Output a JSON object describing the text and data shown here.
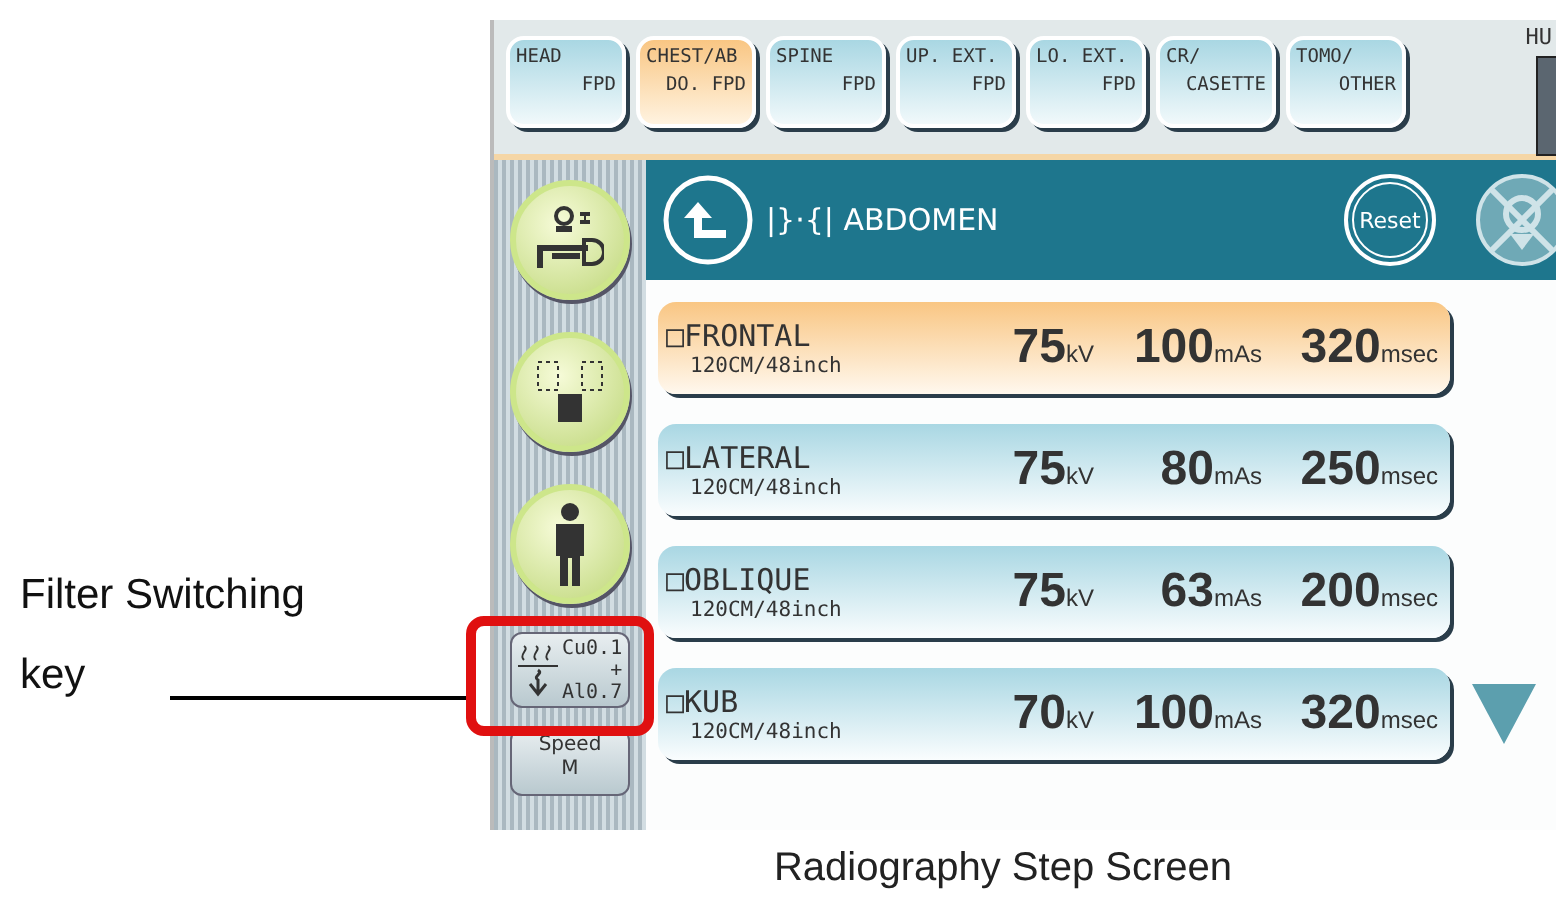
{
  "annotation": {
    "label": "Filter Switching",
    "label_line_2": "key"
  },
  "tabs": [
    {
      "line1": "HEAD",
      "line2": "FPD",
      "selected": false
    },
    {
      "line1": "CHEST/AB",
      "line2": "DO. FPD",
      "selected": true
    },
    {
      "line1": "SPINE",
      "line2": "FPD",
      "selected": false
    },
    {
      "line1": "UP. EXT.",
      "line2": "FPD",
      "selected": false
    },
    {
      "line1": "LO. EXT.",
      "line2": "FPD",
      "selected": false
    },
    {
      "line1": "CR/",
      "line2": "CASETTE",
      "selected": false
    },
    {
      "line1": "TOMO/",
      "line2": "OTHER",
      "selected": false
    }
  ],
  "corner_label": "HU",
  "sidebar": {
    "buttons": [
      {
        "kind": "table"
      },
      {
        "kind": "detector"
      },
      {
        "kind": "person"
      }
    ],
    "filter_key": {
      "top": "Cu0.1",
      "plus": "+",
      "bottom": "Al0.7"
    },
    "speed_key": {
      "label": "Speed",
      "value": "M"
    }
  },
  "header": {
    "title": "|}·{| ABDOMEN",
    "reset": "Reset"
  },
  "steps": [
    {
      "checkbox": "□",
      "name": "FRONTAL",
      "distance": "120CM/48inch",
      "kv": "75",
      "kv_unit": "kV",
      "mas": "100",
      "mas_unit": "mAs",
      "time": "320",
      "time_unit": "msec",
      "selected": true
    },
    {
      "checkbox": "□",
      "name": "LATERAL",
      "distance": "120CM/48inch",
      "kv": "75",
      "kv_unit": "kV",
      "mas": "80",
      "mas_unit": "mAs",
      "time": "250",
      "time_unit": "msec",
      "selected": false
    },
    {
      "checkbox": "□",
      "name": "OBLIQUE",
      "distance": "120CM/48inch",
      "kv": "75",
      "kv_unit": "kV",
      "mas": "63",
      "mas_unit": "mAs",
      "time": "200",
      "time_unit": "msec",
      "selected": false
    },
    {
      "checkbox": "□",
      "name": "KUB",
      "distance": "120CM/48inch",
      "kv": "70",
      "kv_unit": "kV",
      "mas": "100",
      "mas_unit": "mAs",
      "time": "320",
      "time_unit": "msec",
      "selected": false
    }
  ],
  "caption": "Radiography Step Screen"
}
